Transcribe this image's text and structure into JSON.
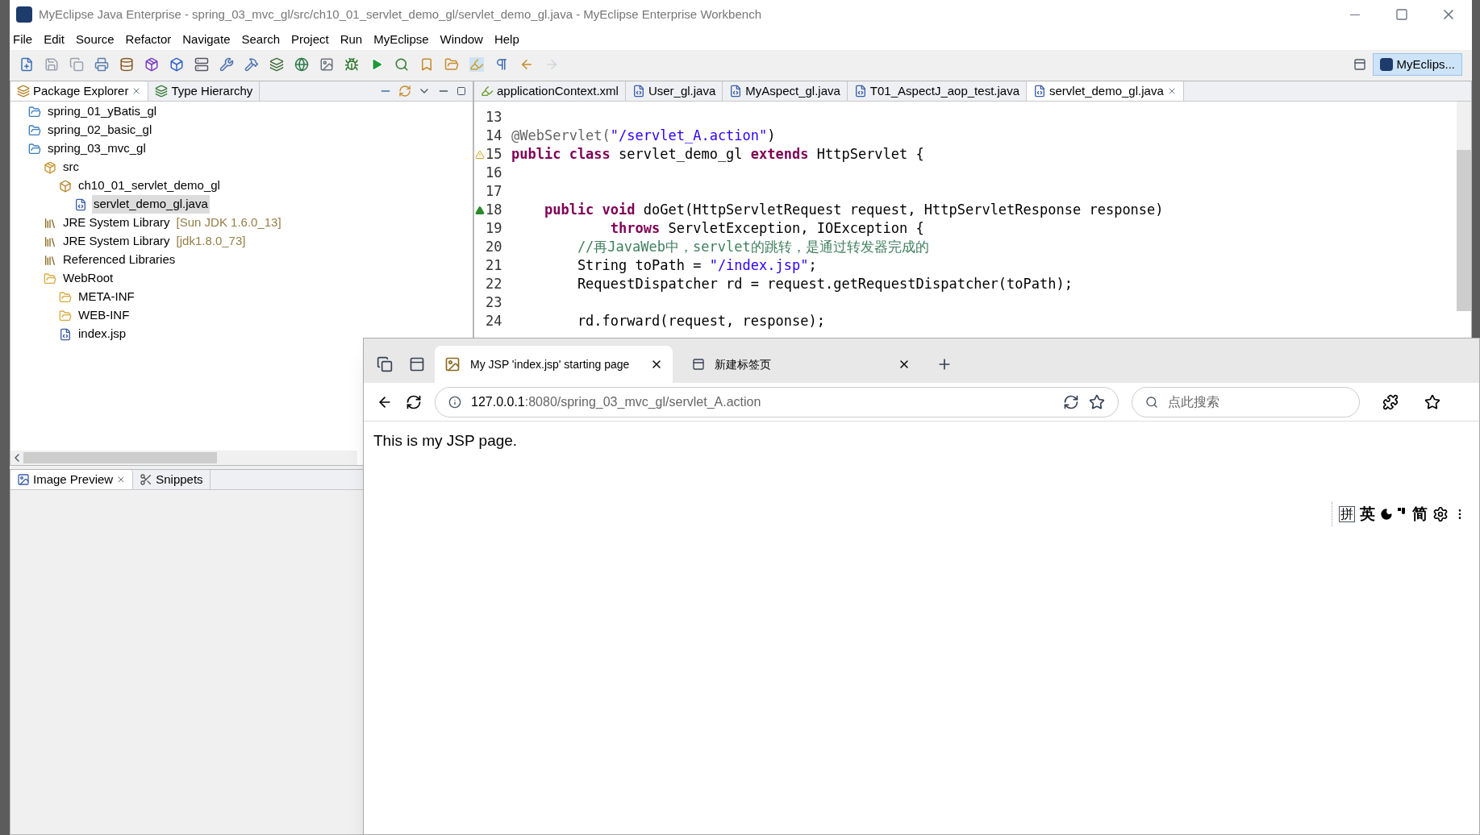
{
  "window": {
    "title": "MyEclipse Java Enterprise - spring_03_mvc_gl/src/ch10_01_servlet_demo_gl/servlet_demo_gl.java - MyEclipse Enterprise Workbench"
  },
  "menu": [
    "File",
    "Edit",
    "Source",
    "Refactor",
    "Navigate",
    "Search",
    "Project",
    "Run",
    "MyEclipse",
    "Window",
    "Help"
  ],
  "perspective": {
    "label": "MyEclips...",
    "selected": true
  },
  "left_panel": {
    "tabs": [
      {
        "label": "Package Explorer",
        "selected": true
      },
      {
        "label": "Type Hierarchy",
        "selected": false
      }
    ],
    "tree": [
      {
        "label": "spring_01_yBatis_gl",
        "kind": "project",
        "selected": false
      },
      {
        "label": "spring_02_basic_gl",
        "kind": "project",
        "selected": false
      },
      {
        "label": "spring_03_mvc_gl",
        "kind": "project",
        "selected": false,
        "children": [
          {
            "label": "src",
            "kind": "source",
            "selected": false,
            "children": [
              {
                "label": "ch10_01_servlet_demo_gl",
                "kind": "package",
                "selected": false,
                "children": [
                  {
                    "label": "servlet_demo_gl.java",
                    "kind": "java",
                    "selected": true
                  }
                ]
              }
            ]
          },
          {
            "label": "JRE System Library",
            "detail": "[Sun JDK 1.6.0_13]",
            "kind": "library",
            "selected": false
          },
          {
            "label": "JRE System Library",
            "detail": "[jdk1.8.0_73]",
            "kind": "library",
            "selected": false
          },
          {
            "label": "Referenced Libraries",
            "kind": "library",
            "selected": false
          },
          {
            "label": "WebRoot",
            "kind": "folder",
            "selected": false,
            "children": [
              {
                "label": "META-INF",
                "kind": "folder",
                "selected": false
              },
              {
                "label": "WEB-INF",
                "kind": "folder",
                "selected": false
              },
              {
                "label": "index.jsp",
                "kind": "jsp",
                "selected": false
              }
            ]
          }
        ]
      }
    ]
  },
  "bottom_panel": {
    "tabs": [
      {
        "label": "Image Preview",
        "selected": true
      },
      {
        "label": "Snippets",
        "selected": false
      }
    ]
  },
  "editor": {
    "tabs": [
      {
        "label": "applicationContext.xml",
        "kind": "xml",
        "selected": false
      },
      {
        "label": "User_gl.java",
        "kind": "java",
        "selected": false
      },
      {
        "label": "MyAspect_gl.java",
        "kind": "java",
        "selected": false
      },
      {
        "label": "T01_AspectJ_aop_test.java",
        "kind": "java",
        "selected": false
      },
      {
        "label": "servlet_demo_gl.java",
        "kind": "java",
        "selected": true
      }
    ],
    "lines": [
      {
        "number": "13",
        "warning": false,
        "override": false
      },
      {
        "number": "14",
        "warning": false,
        "override": false,
        "segments": [
          {
            "text": "@WebServlet(",
            "kind": "annotation"
          },
          {
            "text": "\"/servlet_A.action\"",
            "kind": "string"
          },
          {
            "text": ")",
            "kind": "plain"
          }
        ]
      },
      {
        "number": "15",
        "warning": true,
        "override": false,
        "segments": [
          {
            "text": "public class",
            "kind": "keyword"
          },
          {
            "text": " servlet_demo_gl ",
            "kind": "plain"
          },
          {
            "text": "extends",
            "kind": "keyword"
          },
          {
            "text": " HttpServlet {",
            "kind": "plain"
          }
        ]
      },
      {
        "number": "16",
        "warning": false,
        "override": false
      },
      {
        "number": "17",
        "warning": false,
        "override": false
      },
      {
        "number": "18",
        "warning": false,
        "override": true,
        "segments": [
          {
            "text": "    public void",
            "kind": "keyword"
          },
          {
            "text": " doGet(HttpServletRequest request, HttpServletResponse response)",
            "kind": "plain"
          }
        ]
      },
      {
        "number": "19",
        "warning": false,
        "override": false,
        "segments": [
          {
            "text": "            throws",
            "kind": "keyword"
          },
          {
            "text": " ServletException, IOException {",
            "kind": "plain"
          }
        ]
      },
      {
        "number": "20",
        "warning": false,
        "override": false,
        "segments": [
          {
            "text": "        //再JavaWeb中，servlet的跳转，是通过转发器完成的",
            "kind": "comment"
          }
        ]
      },
      {
        "number": "21",
        "warning": false,
        "override": false,
        "segments": [
          {
            "text": "        String toPath = ",
            "kind": "plain"
          },
          {
            "text": "\"/index.jsp\"",
            "kind": "string"
          },
          {
            "text": ";",
            "kind": "plain"
          }
        ]
      },
      {
        "number": "22",
        "warning": false,
        "override": false,
        "segments": [
          {
            "text": "        RequestDispatcher rd = request.getRequestDispatcher(toPath);",
            "kind": "plain"
          }
        ]
      },
      {
        "number": "23",
        "warning": false,
        "override": false
      },
      {
        "number": "24",
        "warning": false,
        "override": false,
        "segments": [
          {
            "text": "        rd.forward(request, response);",
            "kind": "plain"
          }
        ]
      }
    ]
  },
  "browser": {
    "tabs": [
      {
        "title": "My JSP 'index.jsp' starting page",
        "selected": true
      },
      {
        "title": "新建标签页",
        "selected": false
      }
    ],
    "address": {
      "host": "127.0.0.1",
      "path": ":8080/spring_03_mvc_gl/servlet_A.action"
    },
    "search": {
      "placeholder": "点此搜索"
    },
    "page_text": "This is my JSP page."
  },
  "ime_bar": [
    {
      "kind": "boxed",
      "text": "拼"
    },
    {
      "kind": "text",
      "text": "英"
    },
    {
      "kind": "moon"
    },
    {
      "kind": "punctuation"
    },
    {
      "kind": "text",
      "text": "简"
    },
    {
      "kind": "gear"
    },
    {
      "kind": "more"
    }
  ]
}
